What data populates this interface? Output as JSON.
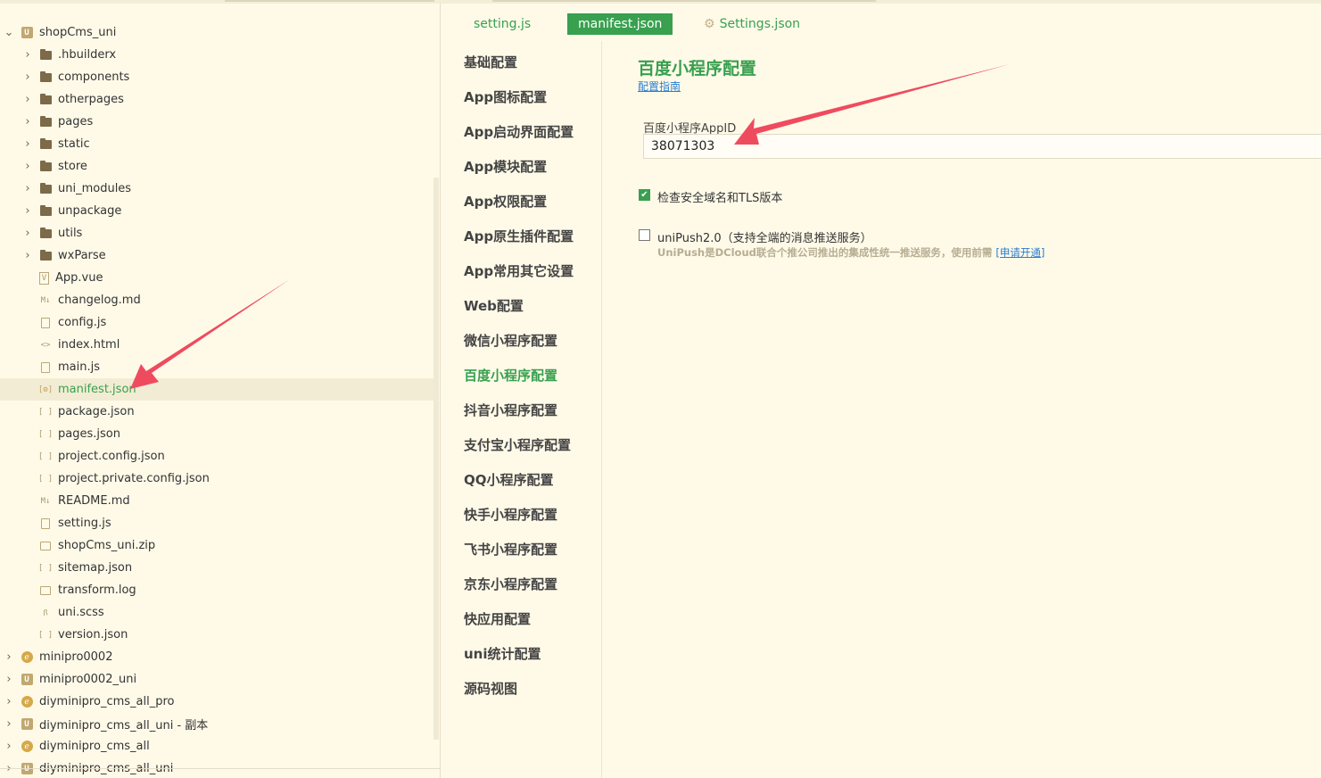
{
  "explorer": {
    "items": [
      {
        "label": "shopCms_uni",
        "type": "project-uni",
        "expanded": true,
        "chevron": "down",
        "level": 0
      },
      {
        "label": ".hbuilderx",
        "type": "folder",
        "chevron": "right",
        "level": 1
      },
      {
        "label": "components",
        "type": "folder",
        "chevron": "right",
        "level": 1
      },
      {
        "label": "otherpages",
        "type": "folder",
        "chevron": "right",
        "level": 1
      },
      {
        "label": "pages",
        "type": "folder",
        "chevron": "right",
        "level": 1
      },
      {
        "label": "static",
        "type": "folder",
        "chevron": "right",
        "level": 1
      },
      {
        "label": "store",
        "type": "folder",
        "chevron": "right",
        "level": 1
      },
      {
        "label": "uni_modules",
        "type": "folder",
        "chevron": "right",
        "level": 1
      },
      {
        "label": "unpackage",
        "type": "folder",
        "chevron": "right",
        "level": 1
      },
      {
        "label": "utils",
        "type": "folder",
        "chevron": "right",
        "level": 1
      },
      {
        "label": "wxParse",
        "type": "folder",
        "chevron": "right",
        "level": 1
      },
      {
        "label": "App.vue",
        "type": "vue",
        "level": 1
      },
      {
        "label": "changelog.md",
        "type": "md",
        "level": 1
      },
      {
        "label": "config.js",
        "type": "js",
        "level": 1
      },
      {
        "label": "index.html",
        "type": "html",
        "level": 1
      },
      {
        "label": "main.js",
        "type": "js",
        "level": 1
      },
      {
        "label": "manifest.json",
        "type": "manifest",
        "level": 1,
        "selected": true
      },
      {
        "label": "package.json",
        "type": "json",
        "level": 1
      },
      {
        "label": "pages.json",
        "type": "json",
        "level": 1
      },
      {
        "label": "project.config.json",
        "type": "json",
        "level": 1
      },
      {
        "label": "project.private.config.json",
        "type": "json",
        "level": 1
      },
      {
        "label": "README.md",
        "type": "md",
        "level": 1
      },
      {
        "label": "setting.js",
        "type": "js",
        "level": 1
      },
      {
        "label": "shopCms_uni.zip",
        "type": "file",
        "level": 1
      },
      {
        "label": "sitemap.json",
        "type": "json",
        "level": 1
      },
      {
        "label": "transform.log",
        "type": "file",
        "level": 1
      },
      {
        "label": "uni.scss",
        "type": "scss",
        "level": 1
      },
      {
        "label": "version.json",
        "type": "json",
        "level": 1
      },
      {
        "label": "minipro0002",
        "type": "project-d",
        "chevron": "right",
        "level": 0
      },
      {
        "label": "minipro0002_uni",
        "type": "project-uni",
        "chevron": "right",
        "level": 0
      },
      {
        "label": "diyminipro_cms_all_pro",
        "type": "project-d",
        "chevron": "right",
        "level": 0
      },
      {
        "label": "diyminipro_cms_all_uni - 副本",
        "type": "project-uni",
        "chevron": "right",
        "level": 0
      },
      {
        "label": "diyminipro_cms_all",
        "type": "project-d",
        "chevron": "right",
        "level": 0
      },
      {
        "label": "diyminipro_cms_all_uni",
        "type": "project-uni",
        "chevron": "right",
        "level": 0
      }
    ]
  },
  "tabs": [
    {
      "label": "setting.js",
      "active": false
    },
    {
      "label": "manifest.json",
      "active": true
    },
    {
      "label": "Settings.json",
      "active": false,
      "icon": "gear-icon"
    }
  ],
  "settings_nav": {
    "items": [
      {
        "label": "基础配置"
      },
      {
        "label": "App图标配置"
      },
      {
        "label": "App启动界面配置"
      },
      {
        "label": "App模块配置"
      },
      {
        "label": "App权限配置"
      },
      {
        "label": "App原生插件配置"
      },
      {
        "label": "App常用其它设置"
      },
      {
        "label": "Web配置"
      },
      {
        "label": "微信小程序配置"
      },
      {
        "label": "百度小程序配置",
        "active": true
      },
      {
        "label": "抖音小程序配置"
      },
      {
        "label": "支付宝小程序配置"
      },
      {
        "label": "QQ小程序配置"
      },
      {
        "label": "快手小程序配置"
      },
      {
        "label": "飞书小程序配置"
      },
      {
        "label": "京东小程序配置"
      },
      {
        "label": "快应用配置"
      },
      {
        "label": "uni统计配置"
      },
      {
        "label": "源码视图"
      }
    ]
  },
  "content": {
    "title": "百度小程序配置",
    "guide_link": "配置指南",
    "appid_label": "百度小程序AppID",
    "appid_value": "38071303",
    "check_tls": {
      "label": "检查安全域名和TLS版本",
      "checked": true
    },
    "unipush": {
      "label": "uniPush2.0（支持全端的消息推送服务）",
      "checked": false,
      "hint": "UniPush是DCloud联合个推公司推出的集成性统一推送服务，使用前需",
      "apply_link": "[申请开通]"
    }
  },
  "colors": {
    "accent": "#38a04f",
    "background": "#fffae8",
    "link": "#2a7ed0",
    "annotation_arrow": "#ef4b5f"
  }
}
